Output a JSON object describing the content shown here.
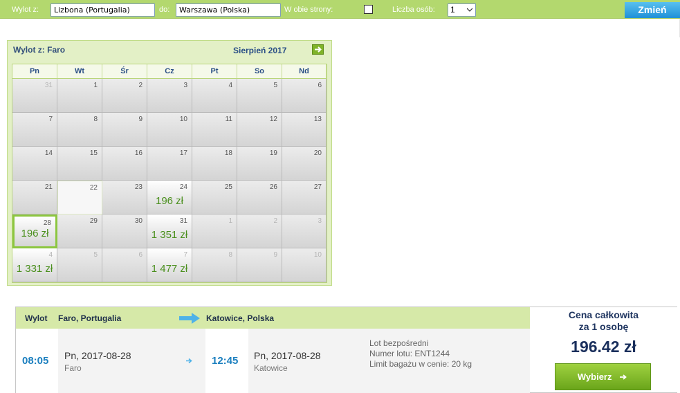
{
  "search": {
    "from_label": "Wylot z:",
    "from_value": "Lizbona (Portugalia)",
    "to_label": "do:",
    "to_value": "Warszawa (Polska)",
    "roundtrip_label": "W obie strony:",
    "roundtrip_checked": false,
    "persons_label": "Liczba osób:",
    "persons_value": "1",
    "change_label": "Zmień"
  },
  "calendar": {
    "from_text": "Wylot z: Faro",
    "month": "Sierpień 2017",
    "weekdays": [
      "Pn",
      "Wt",
      "Śr",
      "Cz",
      "Pt",
      "So",
      "Nd"
    ],
    "weeks": [
      [
        {
          "d": "31",
          "other": true
        },
        {
          "d": "1"
        },
        {
          "d": "2"
        },
        {
          "d": "3"
        },
        {
          "d": "4"
        },
        {
          "d": "5"
        },
        {
          "d": "6"
        }
      ],
      [
        {
          "d": "7"
        },
        {
          "d": "8"
        },
        {
          "d": "9"
        },
        {
          "d": "10"
        },
        {
          "d": "11"
        },
        {
          "d": "12"
        },
        {
          "d": "13"
        }
      ],
      [
        {
          "d": "14"
        },
        {
          "d": "15"
        },
        {
          "d": "16"
        },
        {
          "d": "17"
        },
        {
          "d": "18"
        },
        {
          "d": "19"
        },
        {
          "d": "20"
        }
      ],
      [
        {
          "d": "21"
        },
        {
          "d": "22",
          "blank": true
        },
        {
          "d": "23"
        },
        {
          "d": "24",
          "price": "196 zł"
        },
        {
          "d": "25"
        },
        {
          "d": "26"
        },
        {
          "d": "27"
        }
      ],
      [
        {
          "d": "28",
          "price": "196 zł",
          "selected": true
        },
        {
          "d": "29"
        },
        {
          "d": "30"
        },
        {
          "d": "31",
          "price": "1 351 zł"
        },
        {
          "d": "1",
          "other": true
        },
        {
          "d": "2",
          "other": true
        },
        {
          "d": "3",
          "other": true
        }
      ],
      [
        {
          "d": "4",
          "other": true,
          "price": "1 331 zł"
        },
        {
          "d": "5",
          "other": true
        },
        {
          "d": "6",
          "other": true
        },
        {
          "d": "7",
          "other": true,
          "price": "1 477 zł"
        },
        {
          "d": "8",
          "other": true
        },
        {
          "d": "9",
          "other": true
        },
        {
          "d": "10",
          "other": true
        }
      ]
    ]
  },
  "flight": {
    "departure_label": "Wylot",
    "origin": "Faro, Portugalia",
    "destination": "Katowice, Polska",
    "dep_time": "08:05",
    "dep_day": "Pn",
    "dep_date": "2017-08-28",
    "dep_city": "Faro",
    "arr_time": "12:45",
    "arr_day": "Pn",
    "arr_date": "2017-08-28",
    "arr_city": "Katowice",
    "info_direct": "Lot bezpośredni",
    "info_flight_no": "Numer lotu: ENT1244",
    "info_baggage": "Limit bagażu w cenie: 20 kg"
  },
  "price": {
    "label_line1": "Cena całkowita",
    "label_line2": "za 1 osobę",
    "total": "196.42 zł",
    "choose_label": "Wybierz"
  },
  "colors": {
    "brand_green": "#b3d86e",
    "price_green": "#4a8f1d",
    "time_blue": "#1b7fbf",
    "button_blue": "#1f90d8"
  }
}
